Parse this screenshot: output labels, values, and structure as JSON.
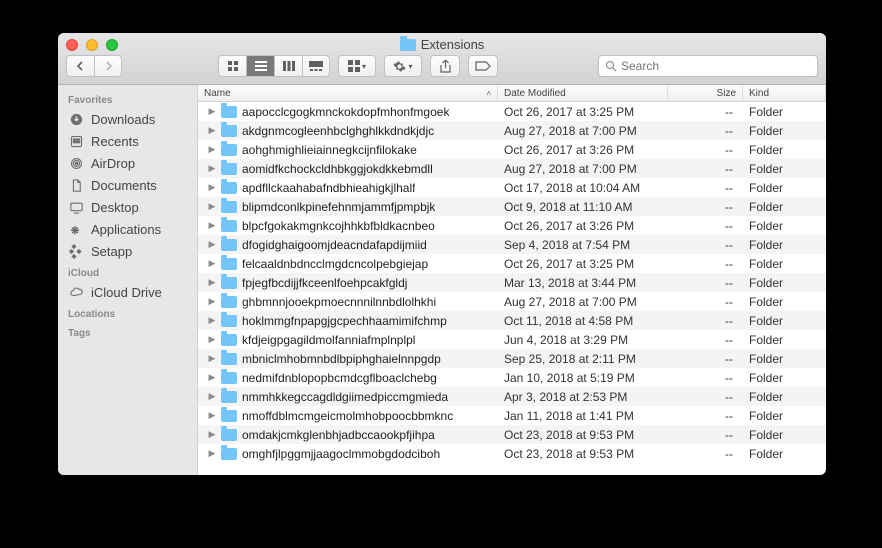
{
  "window": {
    "title": "Extensions"
  },
  "toolbar": {
    "search_placeholder": "Search"
  },
  "columns": {
    "name": "Name",
    "date": "Date Modified",
    "size": "Size",
    "kind": "Kind"
  },
  "sidebar": {
    "sections": [
      {
        "label": "Favorites",
        "items": [
          {
            "label": "Downloads",
            "icon": "downloads-icon"
          },
          {
            "label": "Recents",
            "icon": "recents-icon"
          },
          {
            "label": "AirDrop",
            "icon": "airdrop-icon"
          },
          {
            "label": "Documents",
            "icon": "documents-icon"
          },
          {
            "label": "Desktop",
            "icon": "desktop-icon"
          },
          {
            "label": "Applications",
            "icon": "applications-icon"
          },
          {
            "label": "Setapp",
            "icon": "setapp-icon"
          }
        ]
      },
      {
        "label": "iCloud",
        "items": [
          {
            "label": "iCloud Drive",
            "icon": "icloud-icon"
          }
        ]
      },
      {
        "label": "Locations",
        "items": []
      },
      {
        "label": "Tags",
        "items": []
      }
    ]
  },
  "files": [
    {
      "name": "aapocclcgogkmnckokdopfmhonfmgoek",
      "date": "Oct 26, 2017 at 3:25 PM",
      "size": "--",
      "kind": "Folder"
    },
    {
      "name": "akdgnmcogleenhbclghghlkkdndkjdjc",
      "date": "Aug 27, 2018 at 7:00 PM",
      "size": "--",
      "kind": "Folder"
    },
    {
      "name": "aohghmighlieiainnegkcijnfilokake",
      "date": "Oct 26, 2017 at 3:26 PM",
      "size": "--",
      "kind": "Folder"
    },
    {
      "name": "aomidfkchockcldhbkggjokdkkebmdll",
      "date": "Aug 27, 2018 at 7:00 PM",
      "size": "--",
      "kind": "Folder"
    },
    {
      "name": "apdfllckaahabafndbhieahigkjlhalf",
      "date": "Oct 17, 2018 at 10:04 AM",
      "size": "--",
      "kind": "Folder"
    },
    {
      "name": "blipmdconlkpinefehnmjammfjpmpbjk",
      "date": "Oct 9, 2018 at 11:10 AM",
      "size": "--",
      "kind": "Folder"
    },
    {
      "name": "blpcfgokakmgnkcojhhkbfbldkacnbeo",
      "date": "Oct 26, 2017 at 3:26 PM",
      "size": "--",
      "kind": "Folder"
    },
    {
      "name": "dfogidghaigoomjdeacndafapdijmiid",
      "date": "Sep 4, 2018 at 7:54 PM",
      "size": "--",
      "kind": "Folder"
    },
    {
      "name": "felcaaldnbdncclmgdcncolpebgiejap",
      "date": "Oct 26, 2017 at 3:25 PM",
      "size": "--",
      "kind": "Folder"
    },
    {
      "name": "fpjegfbcdijjfkceenlfoehpcakfgldj",
      "date": "Mar 13, 2018 at 3:44 PM",
      "size": "--",
      "kind": "Folder"
    },
    {
      "name": "ghbmnnjooekpmoecnnnilnnbdlolhkhi",
      "date": "Aug 27, 2018 at 7:00 PM",
      "size": "--",
      "kind": "Folder"
    },
    {
      "name": "hoklmmgfnpapgjgcpechhaamimifchmp",
      "date": "Oct 11, 2018 at 4:58 PM",
      "size": "--",
      "kind": "Folder"
    },
    {
      "name": "kfdjeigpgagildmolfanniafmplnplpl",
      "date": "Jun 4, 2018 at 3:29 PM",
      "size": "--",
      "kind": "Folder"
    },
    {
      "name": "mbniclmhobmnbdlbpiphghaielnnpgdp",
      "date": "Sep 25, 2018 at 2:11 PM",
      "size": "--",
      "kind": "Folder"
    },
    {
      "name": "nedmifdnblopopbcmdcgflboaclchebg",
      "date": "Jan 10, 2018 at 5:19 PM",
      "size": "--",
      "kind": "Folder"
    },
    {
      "name": "nmmhkkegccagdldgiimedpiccmgmieda",
      "date": "Apr 3, 2018 at 2:53 PM",
      "size": "--",
      "kind": "Folder"
    },
    {
      "name": "nmoffdblmcmgeicmolmhobpoocbbmknc",
      "date": "Jan 11, 2018 at 1:41 PM",
      "size": "--",
      "kind": "Folder"
    },
    {
      "name": "omdakjcmkglenbhjadbccaookpfjihpa",
      "date": "Oct 23, 2018 at 9:53 PM",
      "size": "--",
      "kind": "Folder"
    },
    {
      "name": "omghfjlpggmjjaagoclmmobgdodciboh",
      "date": "Oct 23, 2018 at 9:53 PM",
      "size": "--",
      "kind": "Folder"
    }
  ]
}
